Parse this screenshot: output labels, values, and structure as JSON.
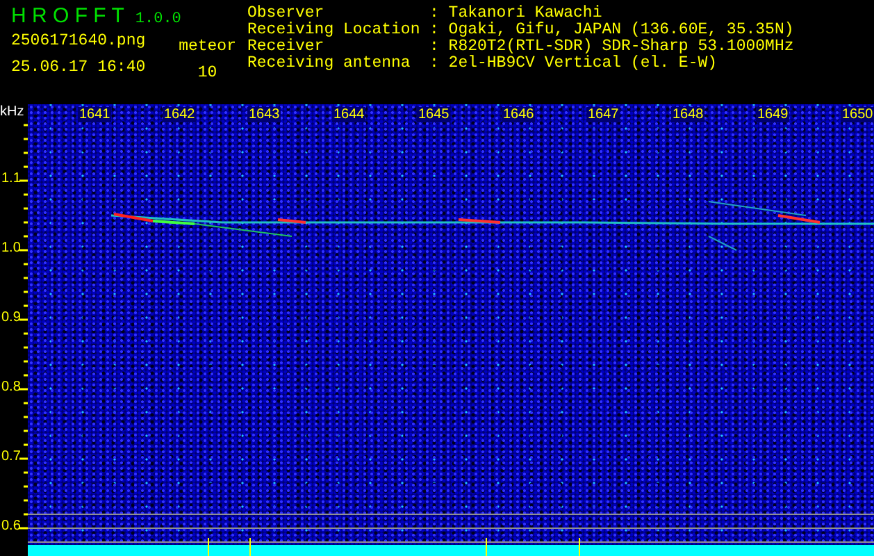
{
  "app": {
    "name": "H R O F F T",
    "version": "1.0.0"
  },
  "file": "2506171640.png",
  "datetime": "25.06.17 16:40",
  "meteor": {
    "label": "meteor",
    "count": "10"
  },
  "info": [
    {
      "label": "Observer",
      "value": ": Takanori Kawachi"
    },
    {
      "label": "Receiving Location",
      "value": ": Ogaki, Gifu, JAPAN (136.60E, 35.35N)"
    },
    {
      "label": "Receiver",
      "value": ": R820T2(RTL-SDR) SDR-Sharp 53.1000MHz"
    },
    {
      "label": "Receiving antenna",
      "value": ": 2el-HB9CV Vertical (el. E-W)"
    }
  ],
  "freq_axis": {
    "unit": "kHz",
    "labels": [
      "1.1",
      "1.0",
      "0.9",
      "0.8",
      "0.7",
      "0.6"
    ]
  },
  "time_labels": [
    "1641",
    "1642",
    "1643",
    "1644",
    "1645",
    "1646",
    "1647",
    "1648",
    "1649",
    "1650"
  ]
}
